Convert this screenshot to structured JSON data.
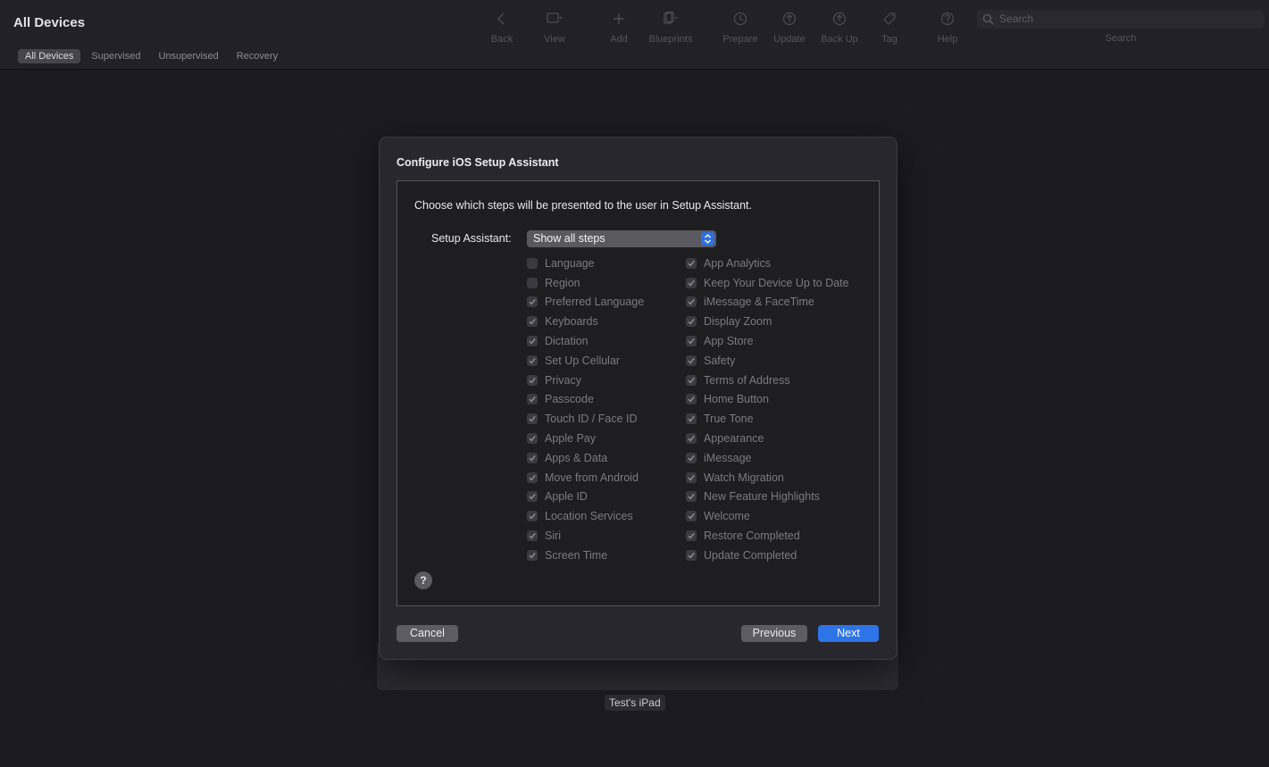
{
  "toolbar": {
    "title": "All Devices",
    "scope_tabs": [
      "All Devices",
      "Supervised",
      "Unsupervised",
      "Recovery"
    ],
    "tools": [
      {
        "label": "Back",
        "icon": "chevron-left-icon"
      },
      {
        "label": "View",
        "icon": "view-icon"
      },
      {
        "label": "Add",
        "icon": "plus-icon"
      },
      {
        "label": "Blueprints",
        "icon": "blueprints-icon"
      },
      {
        "label": "Prepare",
        "icon": "prepare-icon"
      },
      {
        "label": "Update",
        "icon": "update-icon"
      },
      {
        "label": "Back Up",
        "icon": "backup-icon"
      },
      {
        "label": "Tag",
        "icon": "tag-icon"
      },
      {
        "label": "Help",
        "icon": "help-icon"
      }
    ],
    "search_placeholder": "Search",
    "search_label": "Search"
  },
  "device": {
    "name": "Test's iPad"
  },
  "dialog": {
    "title": "Configure iOS Setup Assistant",
    "description": "Choose which steps will be presented to the user in Setup Assistant.",
    "setup_label": "Setup Assistant:",
    "setup_value": "Show all steps",
    "left_options": [
      {
        "label": "Language",
        "checked": false
      },
      {
        "label": "Region",
        "checked": false
      },
      {
        "label": "Preferred Language",
        "checked": true
      },
      {
        "label": "Keyboards",
        "checked": true
      },
      {
        "label": "Dictation",
        "checked": true
      },
      {
        "label": "Set Up Cellular",
        "checked": true
      },
      {
        "label": "Privacy",
        "checked": true
      },
      {
        "label": "Passcode",
        "checked": true
      },
      {
        "label": "Touch ID / Face ID",
        "checked": true
      },
      {
        "label": "Apple Pay",
        "checked": true
      },
      {
        "label": "Apps & Data",
        "checked": true
      },
      {
        "label": "Move from Android",
        "checked": true
      },
      {
        "label": "Apple ID",
        "checked": true
      },
      {
        "label": "Location Services",
        "checked": true
      },
      {
        "label": "Siri",
        "checked": true
      },
      {
        "label": "Screen Time",
        "checked": true
      }
    ],
    "right_options": [
      {
        "label": "App Analytics",
        "checked": true
      },
      {
        "label": "Keep Your Device Up to Date",
        "checked": true
      },
      {
        "label": "iMessage & FaceTime",
        "checked": true
      },
      {
        "label": "Display Zoom",
        "checked": true
      },
      {
        "label": "App Store",
        "checked": true
      },
      {
        "label": "Safety",
        "checked": true
      },
      {
        "label": "Terms of Address",
        "checked": true
      },
      {
        "label": "Home Button",
        "checked": true
      },
      {
        "label": "True Tone",
        "checked": true
      },
      {
        "label": "Appearance",
        "checked": true
      },
      {
        "label": "iMessage",
        "checked": true
      },
      {
        "label": "Watch Migration",
        "checked": true
      },
      {
        "label": "New Feature Highlights",
        "checked": true
      },
      {
        "label": "Welcome",
        "checked": true
      },
      {
        "label": "Restore Completed",
        "checked": true
      },
      {
        "label": "Update Completed",
        "checked": true
      }
    ],
    "help_symbol": "?",
    "cancel_label": "Cancel",
    "previous_label": "Previous",
    "next_label": "Next"
  }
}
